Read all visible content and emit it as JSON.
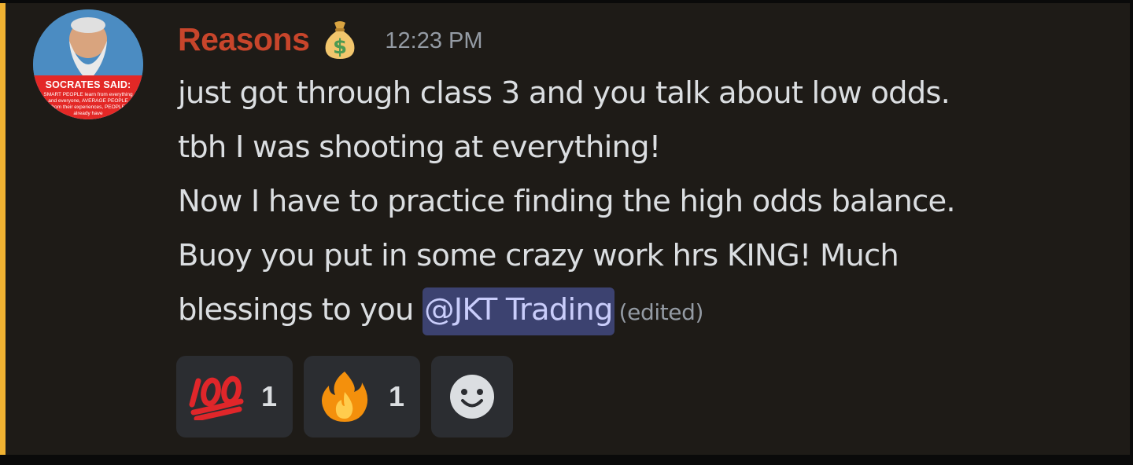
{
  "message": {
    "author": {
      "username": "Reasons",
      "role_emoji": "money-bag-icon",
      "avatar": {
        "caption_title": "SOCRATES SAID:",
        "caption_text": "SMART PEOPLE learn from everything and everyone, AVERAGE PEOPLE from their experiences, PEOPLE already have"
      }
    },
    "timestamp": "12:23 PM",
    "lines": [
      "just got through class 3 and you talk about low odds.",
      "tbh I was shooting at everything!",
      "Now I have to practice finding the high odds balance.",
      "Buoy you put in some crazy work hrs KING! Much",
      "blessings to you"
    ],
    "mention": "@JKT Trading",
    "edited_label": "(edited)"
  },
  "reactions": [
    {
      "emoji": "hundred-points-icon",
      "count": "1"
    },
    {
      "emoji": "fire-icon",
      "count": "1"
    }
  ],
  "add_reaction": {
    "icon": "smiley-add-reaction-icon"
  },
  "colors": {
    "username": "#c8452b",
    "accent_bar": "#f0b232",
    "mention_bg": "#3c4270",
    "mention_text": "#c9cdfb"
  }
}
